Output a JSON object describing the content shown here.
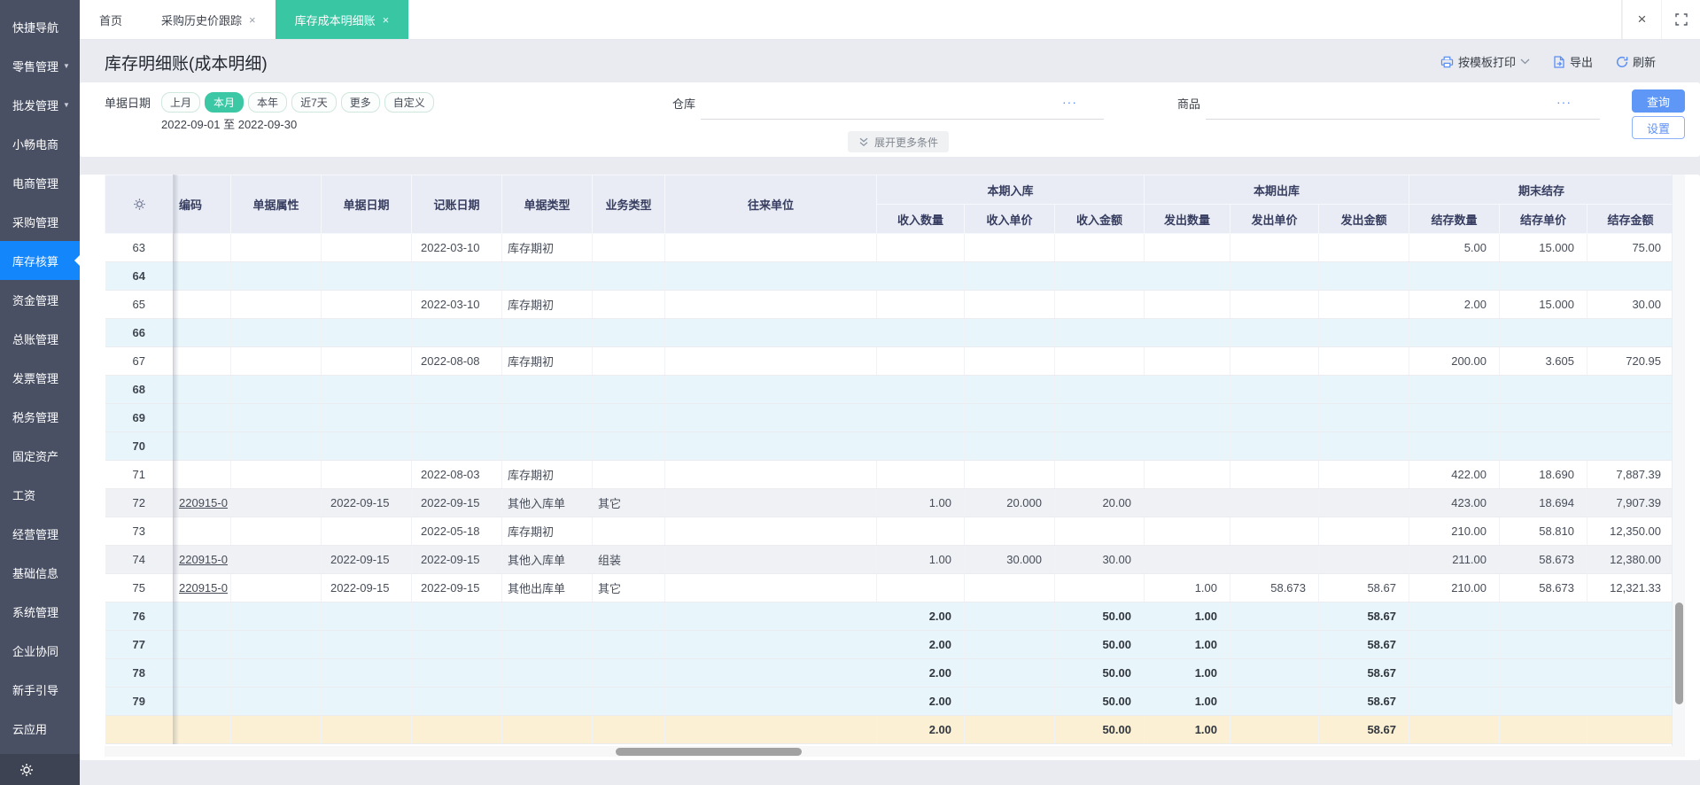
{
  "sidebar": {
    "items": [
      {
        "label": "快捷导航"
      },
      {
        "label": "零售管理",
        "caret": true
      },
      {
        "label": "批发管理",
        "caret": true
      },
      {
        "label": "小畅电商"
      },
      {
        "label": "电商管理"
      },
      {
        "label": "采购管理"
      },
      {
        "label": "库存核算",
        "active": true
      },
      {
        "label": "资金管理"
      },
      {
        "label": "总账管理"
      },
      {
        "label": "发票管理"
      },
      {
        "label": "税务管理"
      },
      {
        "label": "固定资产"
      },
      {
        "label": "工资"
      },
      {
        "label": "经营管理"
      },
      {
        "label": "基础信息"
      },
      {
        "label": "系统管理"
      },
      {
        "label": "企业协同"
      },
      {
        "label": "新手引导"
      },
      {
        "label": "云应用"
      }
    ]
  },
  "tabs": {
    "items": [
      {
        "label": "首页"
      },
      {
        "label": "采购历史价跟踪",
        "closable": true
      },
      {
        "label": "库存成本明细账",
        "closable": true,
        "active": true
      }
    ]
  },
  "window": {
    "close_glyph": "×"
  },
  "icons": {
    "ellipsis": "···",
    "caret_down": "▼",
    "close": "×"
  },
  "page": {
    "title": "库存明细账(成本明细)"
  },
  "toolbar": {
    "print_label": "按模板打印",
    "export_label": "导出",
    "refresh_label": "刷新"
  },
  "filters": {
    "date_label": "单据日期",
    "date_chips": [
      {
        "label": "上月"
      },
      {
        "label": "本月",
        "active": true
      },
      {
        "label": "本年"
      },
      {
        "label": "近7天"
      },
      {
        "label": "更多"
      },
      {
        "label": "自定义"
      }
    ],
    "date_range": "2022-09-01 至 2022-09-30",
    "warehouse_label": "仓库",
    "product_label": "商品",
    "query_label": "查询",
    "settings_label": "设置",
    "expand_label": "展开更多条件"
  },
  "table": {
    "groups": {
      "in": "本期入库",
      "out": "本期出库",
      "balance": "期末结存"
    },
    "headers": {
      "code": "编码",
      "attr": "单据属性",
      "doc_date": "单据日期",
      "acct_date": "记账日期",
      "doc_type": "单据类型",
      "biz_type": "业务类型",
      "partner": "往来单位",
      "in_qty": "收入数量",
      "in_price": "收入单价",
      "in_amt": "收入金额",
      "out_qty": "发出数量",
      "out_price": "发出单价",
      "out_amt": "发出金额",
      "bal_qty": "结存数量",
      "bal_price": "结存单价",
      "bal_amt": "结存金额"
    },
    "rows": [
      {
        "num": "63",
        "variant": "plain",
        "acct_date": "2022-03-10",
        "doc_type": "库存期初",
        "bal_qty": "5.00",
        "bal_price": "15.000",
        "bal_amt": "75.00"
      },
      {
        "num": "64",
        "variant": "summary"
      },
      {
        "num": "65",
        "variant": "plain",
        "acct_date": "2022-03-10",
        "doc_type": "库存期初",
        "bal_qty": "2.00",
        "bal_price": "15.000",
        "bal_amt": "30.00"
      },
      {
        "num": "66",
        "variant": "summary"
      },
      {
        "num": "67",
        "variant": "plain",
        "acct_date": "2022-08-08",
        "doc_type": "库存期初",
        "bal_qty": "200.00",
        "bal_price": "3.605",
        "bal_amt": "720.95"
      },
      {
        "num": "68",
        "variant": "summary"
      },
      {
        "num": "69",
        "variant": "summary"
      },
      {
        "num": "70",
        "variant": "summary"
      },
      {
        "num": "71",
        "variant": "plain",
        "acct_date": "2022-08-03",
        "doc_type": "库存期初",
        "bal_qty": "422.00",
        "bal_price": "18.690",
        "bal_amt": "7,887.39"
      },
      {
        "num": "72",
        "variant": "stripe",
        "code": "220915-0",
        "doc_date": "2022-09-15",
        "acct_date": "2022-09-15",
        "doc_type": "其他入库单",
        "biz_type": "其它",
        "in_qty": "1.00",
        "in_price": "20.000",
        "in_amt": "20.00",
        "bal_qty": "423.00",
        "bal_price": "18.694",
        "bal_amt": "7,907.39"
      },
      {
        "num": "73",
        "variant": "plain",
        "acct_date": "2022-05-18",
        "doc_type": "库存期初",
        "bal_qty": "210.00",
        "bal_price": "58.810",
        "bal_amt": "12,350.00"
      },
      {
        "num": "74",
        "variant": "stripe",
        "code": "220915-0",
        "doc_date": "2022-09-15",
        "acct_date": "2022-09-15",
        "doc_type": "其他入库单",
        "biz_type": "组装",
        "in_qty": "1.00",
        "in_price": "30.000",
        "in_amt": "30.00",
        "bal_qty": "211.00",
        "bal_price": "58.673",
        "bal_amt": "12,380.00"
      },
      {
        "num": "75",
        "variant": "plain",
        "code": "220915-0",
        "doc_date": "2022-09-15",
        "acct_date": "2022-09-15",
        "doc_type": "其他出库单",
        "biz_type": "其它",
        "out_qty": "1.00",
        "out_price": "58.673",
        "out_amt": "58.67",
        "bal_qty": "210.00",
        "bal_price": "58.673",
        "bal_amt": "12,321.33"
      },
      {
        "num": "76",
        "variant": "summary",
        "bold": true,
        "in_qty": "2.00",
        "in_amt": "50.00",
        "out_qty": "1.00",
        "out_amt": "58.67"
      },
      {
        "num": "77",
        "variant": "summary",
        "bold": true,
        "in_qty": "2.00",
        "in_amt": "50.00",
        "out_qty": "1.00",
        "out_amt": "58.67"
      },
      {
        "num": "78",
        "variant": "summary",
        "bold": true,
        "in_qty": "2.00",
        "in_amt": "50.00",
        "out_qty": "1.00",
        "out_amt": "58.67"
      },
      {
        "num": "79",
        "variant": "summary",
        "bold": true,
        "in_qty": "2.00",
        "in_amt": "50.00",
        "out_qty": "1.00",
        "out_amt": "58.67"
      },
      {
        "num": "",
        "variant": "total",
        "bold": true,
        "in_qty": "2.00",
        "in_amt": "50.00",
        "out_qty": "1.00",
        "out_amt": "58.67"
      }
    ]
  },
  "colors": {
    "sidebar_bg": "#4a5064",
    "sidebar_active": "#1486fb",
    "tab_active": "#38c6a3",
    "chip_active": "#3cc8a4",
    "primary_button": "#5e97f5",
    "header_bg": "#e9ecf4",
    "summary_row_bg": "#e8f6fb",
    "stripe_row_bg": "#f0f1f5",
    "total_row_bg": "#fbf0d3"
  }
}
